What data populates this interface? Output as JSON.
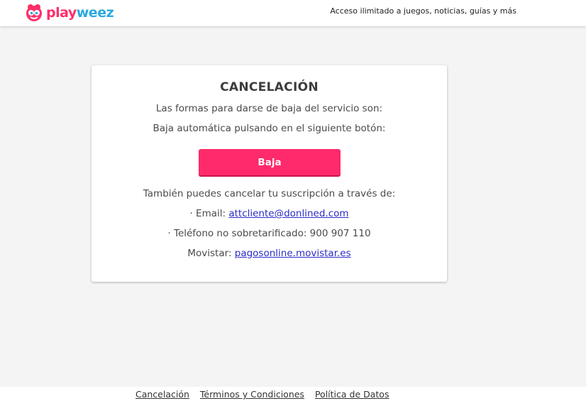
{
  "header": {
    "logo": {
      "part1": "play",
      "part2": "weez"
    },
    "tagline": "Acceso ilimitado a juegos, noticias, guías y más"
  },
  "card": {
    "title": "CANCELACIÓN",
    "intro": "Las formas para darse de baja del servicio son:",
    "auto_text": "Baja automática pulsando en el siguiente botón:",
    "button_label": "Baja",
    "alt_text": "También puedes cancelar tu suscripción a través de:",
    "email_prefix": "· Email: ",
    "email_link": "attcliente@donlined.com",
    "phone_text": "· Teléfono no sobretarificado: 900 907 110",
    "movistar_prefix": "Movistar: ",
    "movistar_link": "pagosonline.movistar.es"
  },
  "footer": {
    "links": [
      "Cancelación",
      "Términos y Condiciones",
      "Política de Datos"
    ]
  },
  "colors": {
    "brand_pink": "#ff2a6b",
    "brand_blue": "#2aa9e0",
    "link_blue": "#2c2cc9",
    "background": "#f4f4f4"
  }
}
